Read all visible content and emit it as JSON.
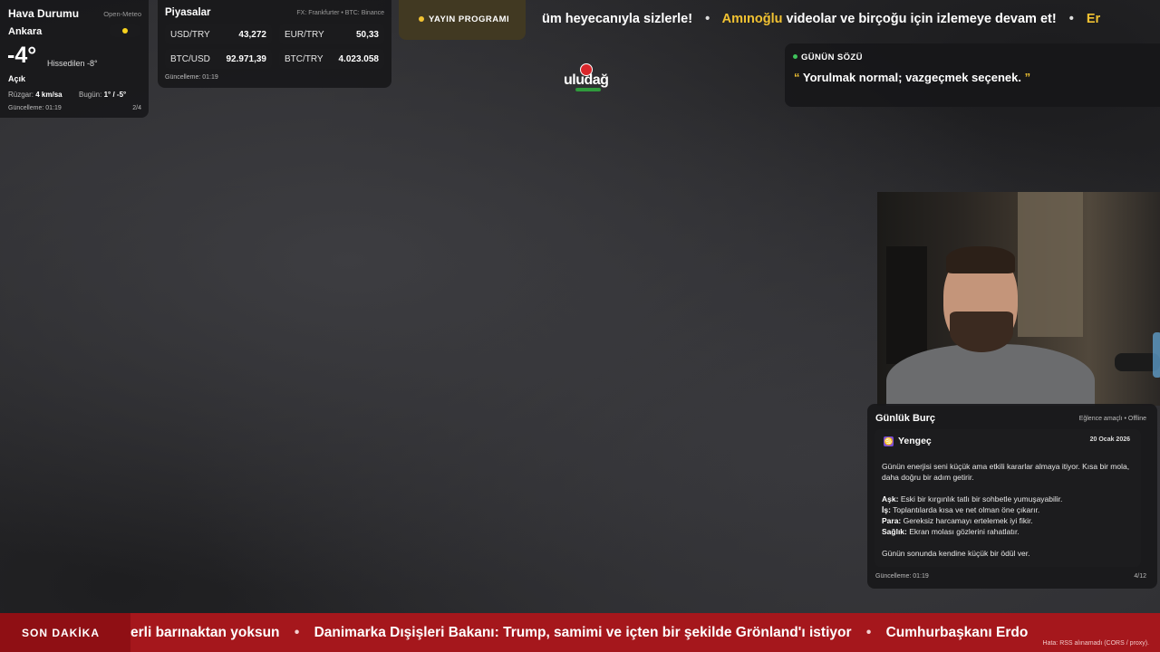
{
  "weather": {
    "title": "Hava Durumu",
    "source": "Open-Meteo",
    "city": "Ankara",
    "temperature": "-4°",
    "feels_like": "Hissedilen -8°",
    "condition": "Açık",
    "wind_label": "Rüzgar:",
    "wind_value": "4 km/sa",
    "today_label": "Bugün:",
    "today_value": "1° / -5°",
    "updated": "Güncelleme: 01:19",
    "page": "2/4",
    "icon": "sun-icon"
  },
  "markets": {
    "title": "Piyasalar",
    "source": "FX: Frankfurter • BTC: Binance",
    "rows": [
      {
        "label": "USD/TRY",
        "value": "43,272"
      },
      {
        "label": "EUR/TRY",
        "value": "50,33"
      },
      {
        "label": "BTC/USD",
        "value": "92.971,39"
      },
      {
        "label": "BTC/TRY",
        "value": "4.023.058"
      }
    ],
    "updated": "Güncelleme: 01:19"
  },
  "top_ticker": {
    "schedule_label": "YAYIN PROGRAMI",
    "part1": "üm heyecanıyla sizlerle!",
    "highlight": "Amınoğlu",
    "part2": "videolar ve birçoğu için izlemeye devam et!",
    "part3": "Er"
  },
  "logo": {
    "text": "uludağ"
  },
  "quote": {
    "label": "GÜNÜN SÖZÜ",
    "open_mark": "“",
    "text": "Yorulmak normal; vazgeçmek seçenek.",
    "close_mark": "”"
  },
  "horoscope": {
    "title": "Günlük Burç",
    "note": "Eğlence amaçlı • Offline",
    "sign": "Yengeç",
    "date": "20 Ocak 2026",
    "intro": "Günün enerjisi seni küçük ama etkili kararlar almaya itiyor. Kısa bir mola, daha doğru bir adım getirir.",
    "love_label": "Aşk:",
    "love": "Eski bir kırgınlık tatlı bir sohbetle yumuşayabilir.",
    "work_label": "İş:",
    "work": "Toplantılarda kısa ve net olman öne çıkarır.",
    "money_label": "Para:",
    "money": "Gereksiz harcamayı ertelemek iyi fikir.",
    "health_label": "Sağlık:",
    "health": "Ekran molası gözlerini rahatlatır.",
    "closing": "Günün sonunda kendine küçük bir ödül ver.",
    "updated": "Güncelleme: 01:19",
    "page": "4/12"
  },
  "news": {
    "badge": "SON DAKİKA",
    "item1": "erli barınaktan yoksun",
    "item2": "Danimarka Dışişleri Bakanı: Trump, samimi ve içten bir şekilde Grönland'ı istiyor",
    "item3": "Cumhurbaşkanı Erdo",
    "error": "Hata: RSS alınamadı (CORS / proxy)."
  }
}
